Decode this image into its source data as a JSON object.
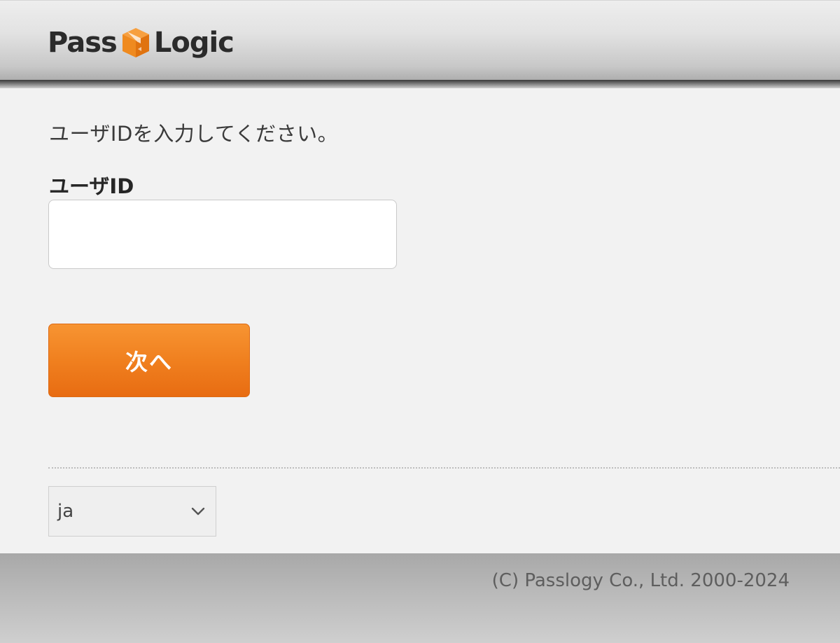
{
  "header": {
    "logo_text_left": "Pass",
    "logo_text_right": "Logic",
    "logo_icon": "orange-box-icon",
    "brand_color": "#f08a24"
  },
  "form": {
    "instruction": "ユーザIDを入力してください。",
    "userid_label": "ユーザID",
    "userid_value": "",
    "userid_placeholder": "",
    "next_button_label": "次へ",
    "button_color": "#f08020"
  },
  "language": {
    "selected": "ja",
    "icon": "chevron-down-icon"
  },
  "footer": {
    "copyright": "(C) Passlogy Co., Ltd. 2000-2024"
  }
}
